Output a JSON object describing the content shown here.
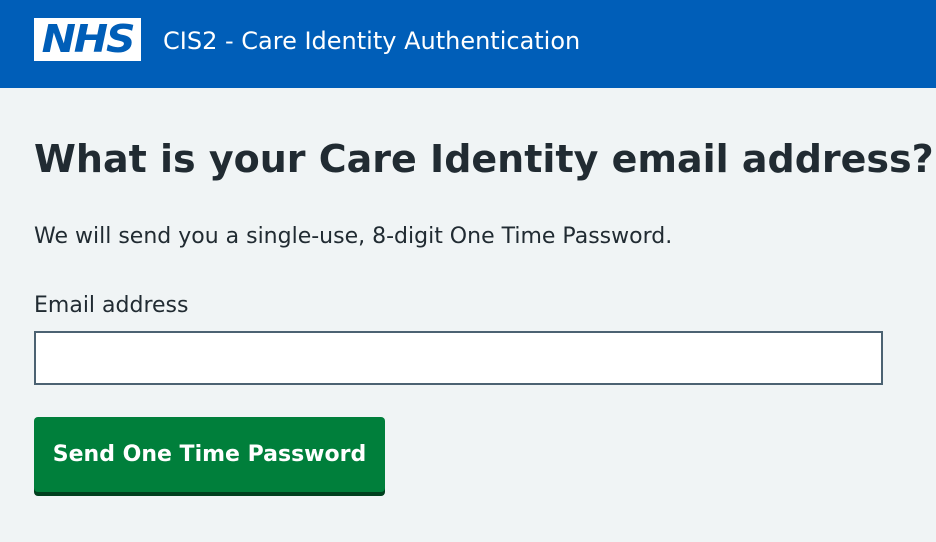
{
  "header": {
    "logo_text": "NHS",
    "service_name": "CIS2 - Care Identity Authentication",
    "brand_color": "#005eb8"
  },
  "main": {
    "title": "What is your Care Identity email address?",
    "hint": "We will send you a single-use, 8-digit One Time Password.",
    "email_label": "Email address",
    "email_value": "",
    "email_placeholder": "",
    "submit_label": "Send One Time Password",
    "button_color": "#007f3b"
  }
}
